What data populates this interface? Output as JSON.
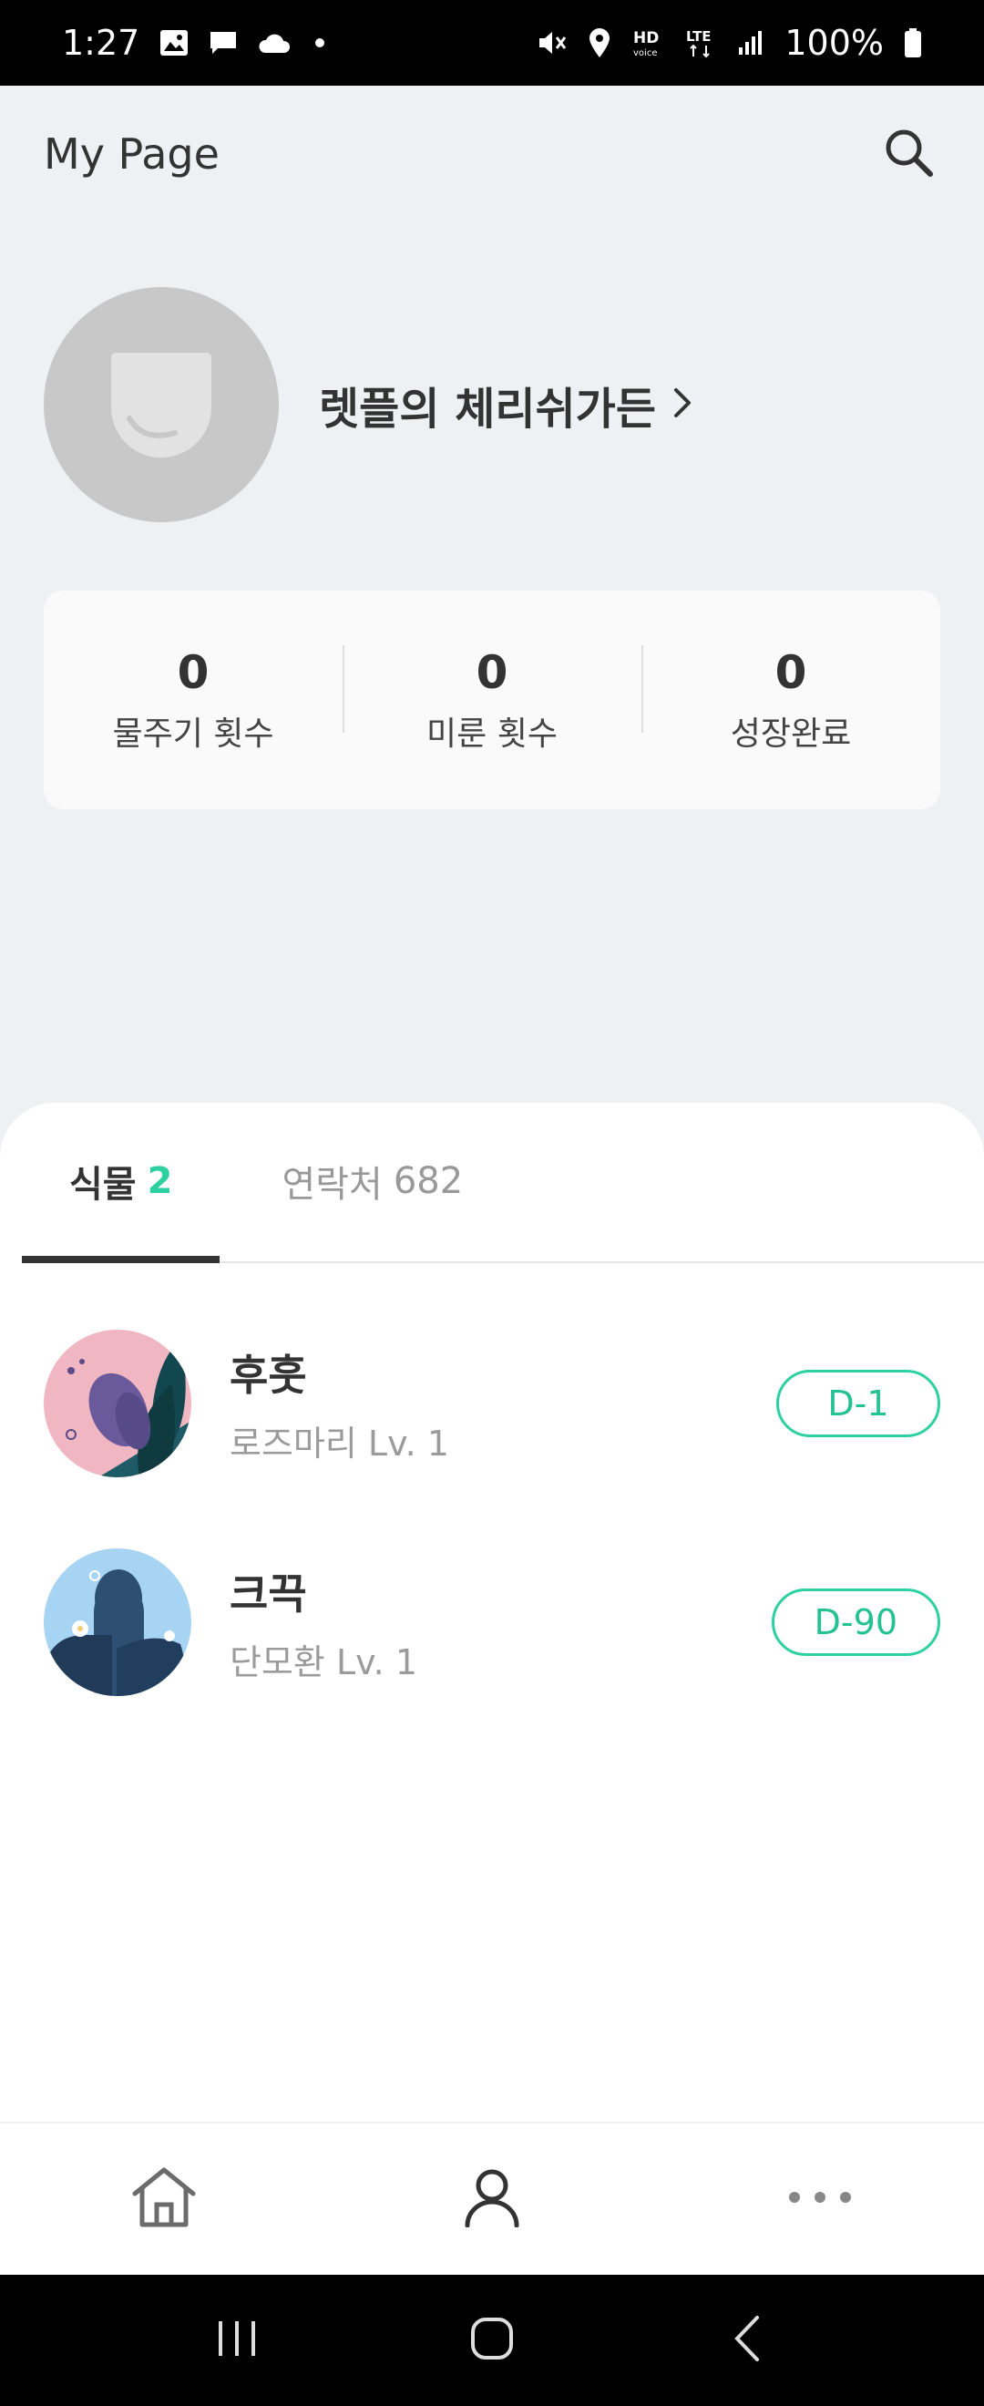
{
  "status_bar": {
    "time": "1:27",
    "battery": "100%",
    "icons": [
      "image-icon",
      "chat-icon",
      "cloud-icon",
      "dot-icon",
      "mute-icon",
      "location-icon",
      "hd-voice-icon",
      "lte-icon",
      "signal-icon",
      "battery-icon"
    ]
  },
  "header": {
    "title": "My Page",
    "search_icon": "search-icon"
  },
  "profile": {
    "name": "렛플의 체리쉬가든",
    "avatar_icon": "leaf-icon"
  },
  "stats": [
    {
      "value": "0",
      "label": "물주기 횟수"
    },
    {
      "value": "0",
      "label": "미룬 횟수"
    },
    {
      "value": "0",
      "label": "성장완료"
    }
  ],
  "tabs": {
    "plants_label": "식물",
    "plants_count": "2",
    "contacts_label": "연락처",
    "contacts_count": "682"
  },
  "plants": [
    {
      "name": "후훗",
      "species": "로즈마리 Lv. 1",
      "dday": "D-1"
    },
    {
      "name": "크끅",
      "species": "단모환 Lv. 1",
      "dday": "D-90"
    }
  ],
  "bottom_nav": [
    "home-icon",
    "profile-icon",
    "more-icon"
  ],
  "colors": {
    "accent": "#2dd0a0",
    "background": "#eff0f4",
    "text": "#333333"
  }
}
